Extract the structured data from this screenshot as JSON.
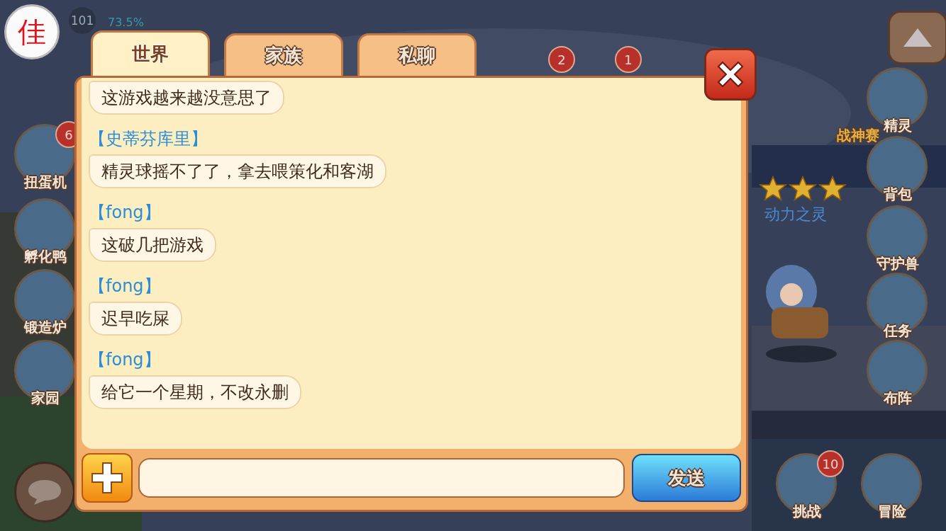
{
  "hud": {
    "corner_badge": "佳",
    "player_level": "101",
    "exp_percent": "73.5%",
    "left_menu": [
      {
        "label": "扭蛋机",
        "badge": "6"
      },
      {
        "label": "孵化鸭"
      },
      {
        "label": "锻造炉"
      },
      {
        "label": "家园"
      }
    ],
    "right_menu": [
      {
        "label": "精灵"
      },
      {
        "label": "背包"
      },
      {
        "label": "守护兽"
      },
      {
        "label": "任务"
      },
      {
        "label": "布阵"
      }
    ],
    "bottom_menu": [
      {
        "label": "挑战",
        "badge": "10"
      },
      {
        "label": "冒险"
      }
    ],
    "top_badges": [
      "2",
      "1"
    ],
    "scene_texts": [
      "战神赛",
      "动力之灵"
    ],
    "stars": 3
  },
  "chat": {
    "tabs": [
      {
        "label": "世界",
        "selected": true
      },
      {
        "label": "家族",
        "selected": false
      },
      {
        "label": "私聊",
        "selected": false
      }
    ],
    "messages": [
      {
        "text": "这游戏越来越没意思了"
      },
      {
        "sender": "【史蒂芬库里】",
        "text": "精灵球摇不了了，拿去喂策化和客湖"
      },
      {
        "sender": "【fong】",
        "text": "这破几把游戏"
      },
      {
        "sender": "【fong】",
        "text": "迟早吃屎"
      },
      {
        "sender": "【fong】",
        "text": "给它一个星期，不改永删"
      }
    ],
    "send_button": "发送"
  }
}
